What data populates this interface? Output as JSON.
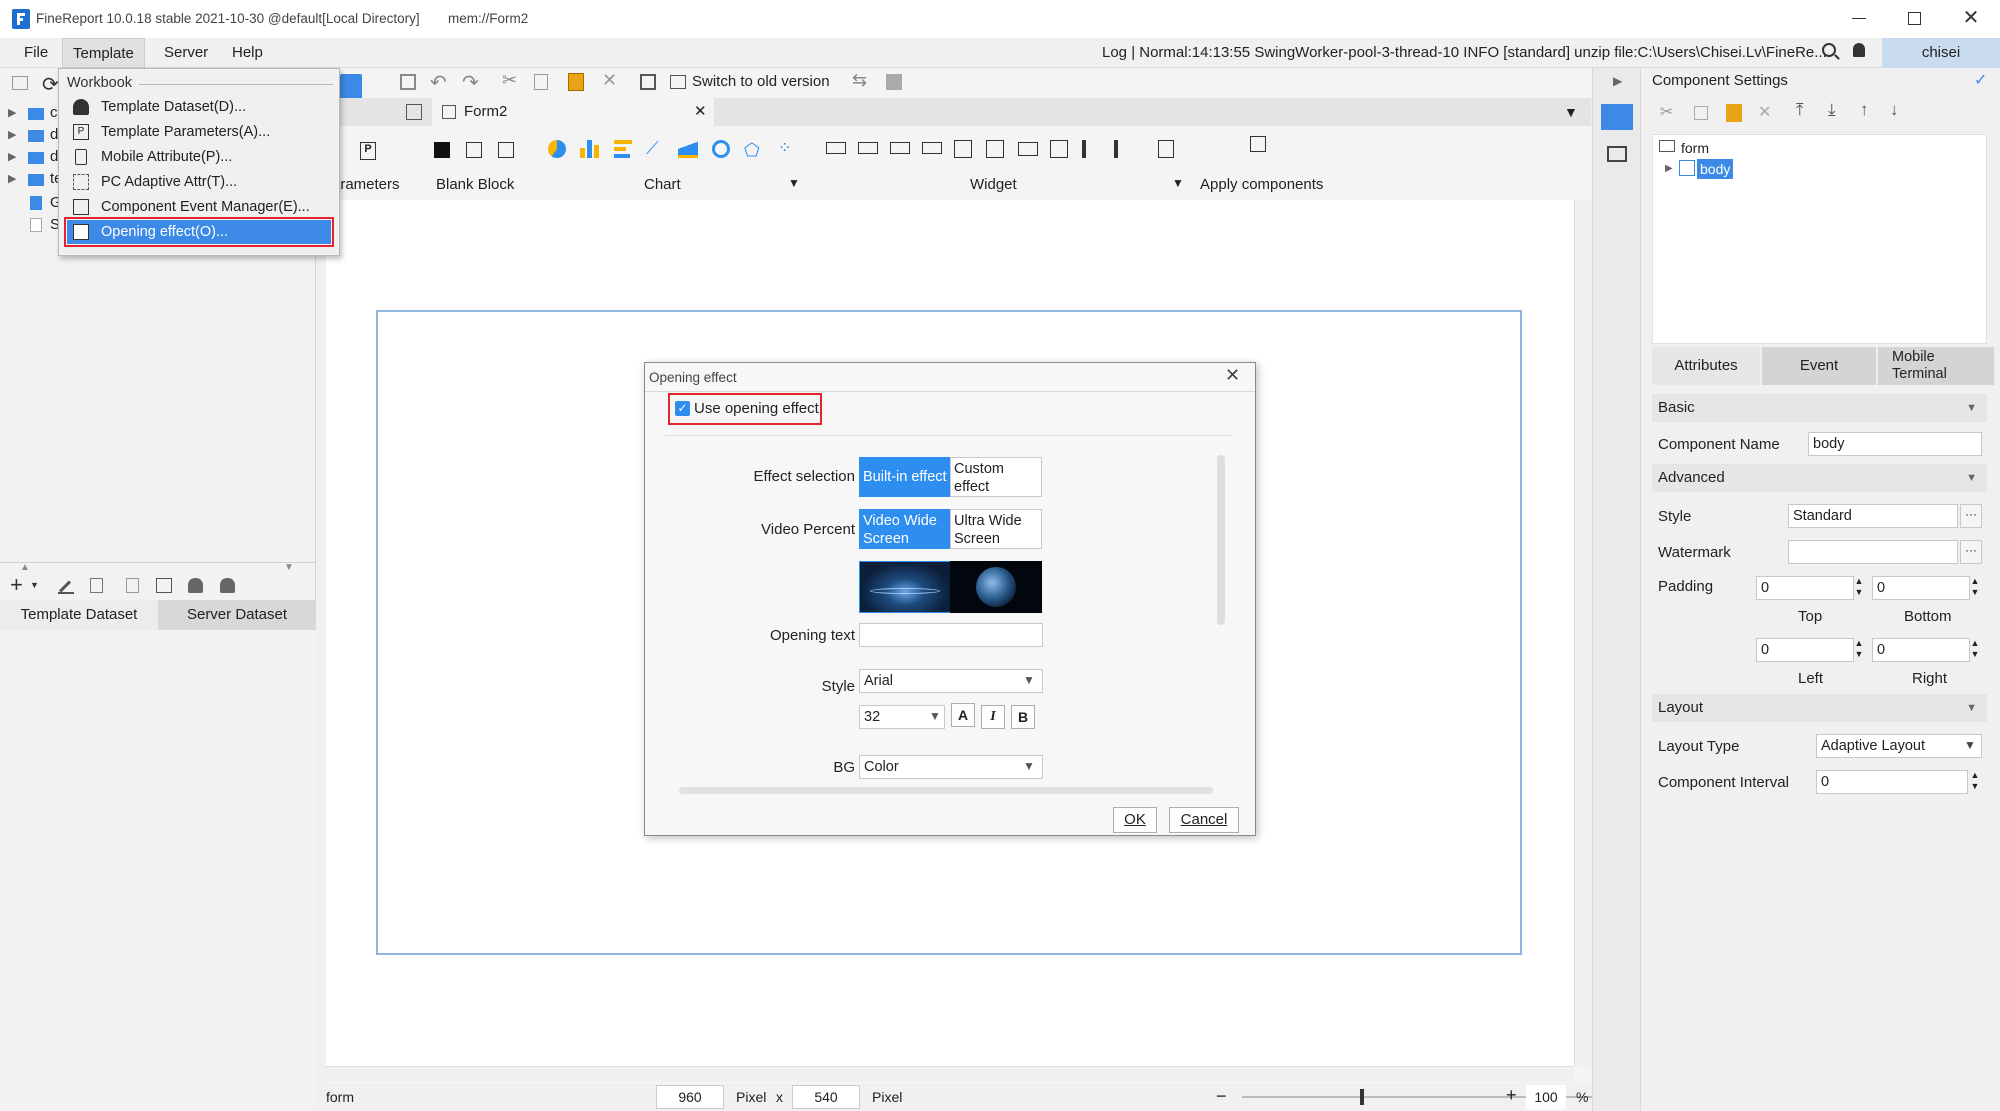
{
  "window": {
    "title": "FineReport 10.0.18 stable 2021-10-30 @default[Local Directory]",
    "path": "mem://Form2",
    "colors": {
      "accent": "#2e8ef0",
      "highlight_outline": "#e0262e",
      "form_border": "#8fb7e2",
      "user_badge": "#c9dbef"
    }
  },
  "menubar": {
    "items": [
      "File",
      "Template",
      "Server",
      "Help"
    ],
    "log": "Log | Normal:14:13:55 SwingWorker-pool-3-thread-10 INFO [standard] unzip file:C:\\Users\\Chisei.Lv\\FineRe...",
    "user": "chisei"
  },
  "dropdown": {
    "header": "Workbook",
    "items": [
      "Template Dataset(D)...",
      "Template Parameters(A)...",
      "Mobile Attribute(P)...",
      "PC Adaptive Attr(T)...",
      "Component Event Manager(E)...",
      "Opening effect(O)..."
    ],
    "selected_index": 5
  },
  "toolbar": {
    "switch_old": "Switch to old version",
    "tab": "Form2",
    "groups": [
      "arameters",
      "Blank Block",
      "Chart",
      "Widget",
      "Apply components"
    ]
  },
  "leftpanel": {
    "tree_letters": [
      "c",
      "d",
      "d",
      "te",
      "G",
      "S"
    ],
    "tabs": [
      "Template Dataset",
      "Server Dataset"
    ]
  },
  "dialog": {
    "title": "Opening effect",
    "use_checkbox": "Use opening effect",
    "use_checked": true,
    "effect_selection_label": "Effect selection",
    "effect_options": [
      "Built-in effect",
      "Custom effect"
    ],
    "effect_selected": 0,
    "video_percent_label": "Video Percent",
    "video_options": [
      "Video Wide Screen",
      "Ultra Wide Screen"
    ],
    "video_selected": 0,
    "opening_text_label": "Opening text",
    "opening_text_value": "",
    "style_label": "Style",
    "font_value": "Arial",
    "size_value": "32",
    "style_buttons": [
      "A",
      "I",
      "B"
    ],
    "bg_label": "BG",
    "bg_value": "Color",
    "ok": "OK",
    "cancel": "Cancel"
  },
  "statusbar": {
    "left": "form",
    "width": "960",
    "height": "540",
    "unit": "Pixel",
    "x": "x",
    "zoom": "100",
    "percent": "%"
  },
  "rightpanel": {
    "header": "Component Settings",
    "tree_root": "form",
    "tree_child": "body",
    "tabs": [
      "Attributes",
      "Event",
      "Mobile Terminal"
    ],
    "basic": "Basic",
    "component_name_label": "Component Name",
    "component_name_value": "body",
    "advanced": "Advanced",
    "style_label": "Style",
    "style_value": "Standard",
    "watermark_label": "Watermark",
    "watermark_value": "",
    "padding_label": "Padding",
    "padding_top": "0",
    "padding_bottom": "0",
    "padding_left": "0",
    "padding_right": "0",
    "top_label": "Top",
    "bottom_label": "Bottom",
    "left_label": "Left",
    "right_label": "Right",
    "layout": "Layout",
    "layout_type_label": "Layout Type",
    "layout_type_value": "Adaptive Layout",
    "interval_label": "Component Interval",
    "interval_value": "0"
  }
}
